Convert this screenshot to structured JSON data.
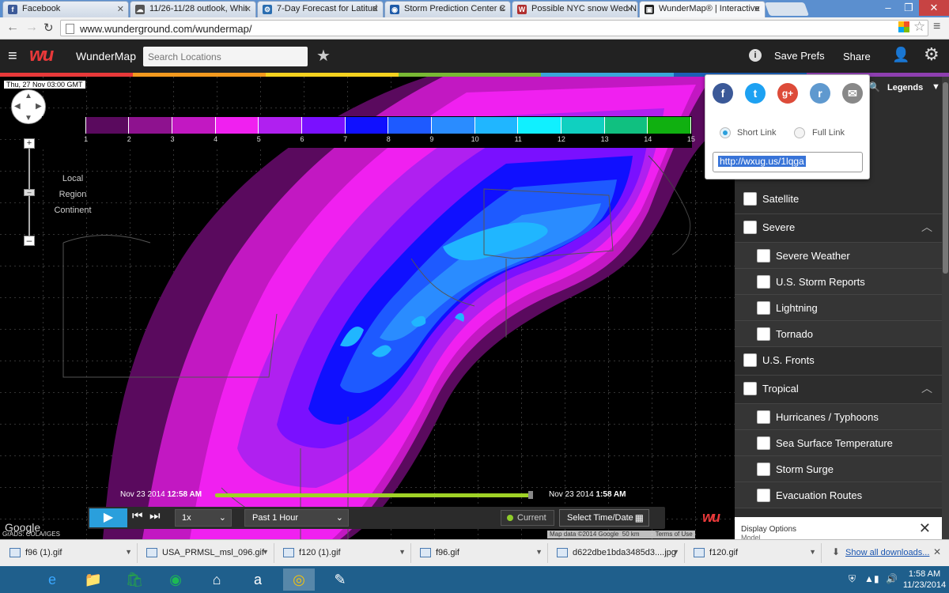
{
  "browser": {
    "tabs": [
      {
        "label": "Facebook",
        "icon": "facebook-icon",
        "color": "#3b5998",
        "glyph": "f"
      },
      {
        "label": "11/26-11/28 outlook, Whit",
        "icon": "forum-icon",
        "color": "#555555",
        "glyph": "☁"
      },
      {
        "label": "7-Day Forecast for Latitud",
        "icon": "nws-icon",
        "color": "#2a6db0",
        "glyph": "⚙"
      },
      {
        "label": "Storm Prediction Center C",
        "icon": "noaa-icon",
        "color": "#1e5aa8",
        "glyph": "◉"
      },
      {
        "label": "Possible NYC snow Wed N",
        "icon": "weather-forum-icon",
        "color": "#b03030",
        "glyph": "W"
      },
      {
        "label": "WunderMap® | Interactive",
        "icon": "wundermap-icon",
        "color": "#222222",
        "glyph": "▣"
      }
    ],
    "url": "www.wunderground.com/wundermap/"
  },
  "header": {
    "logo": "wu",
    "title": "WunderMap",
    "search_placeholder": "Search Locations",
    "save_prefs": "Save Prefs",
    "share": "Share"
  },
  "map": {
    "timestamp": "Thu, 27 Nov   03:00 GMT",
    "zoom_labels": [
      "Local",
      "Region",
      "Continent"
    ],
    "colorbar": {
      "labels": [
        "1",
        "2",
        "3",
        "4",
        "5",
        "6",
        "7",
        "8",
        "9",
        "10",
        "11",
        "12",
        "13",
        "14",
        "15"
      ],
      "colors": [
        "#000000",
        "#5a0a5e",
        "#8e128f",
        "#c218c2",
        "#f020f0",
        "#b020f0",
        "#7a10ff",
        "#1010ff",
        "#1e5aff",
        "#2a8cff",
        "#20b6ff",
        "#10f0ff",
        "#10d0c0",
        "#10c080",
        "#10b010"
      ]
    },
    "google_logo": "Google",
    "grads": "GrADS: COLA/IGES",
    "attribution": {
      "map_data": "Map data ©2014 Google",
      "scale": "50 km",
      "terms": "Terms of Use"
    }
  },
  "timeline": {
    "start_date": "Nov 23 2014",
    "start_time": "12:58 AM",
    "end_date": "Nov 23 2014",
    "end_time": "1:58 AM",
    "speed": "1x",
    "range": "Past 1 Hour",
    "current": "Current",
    "select_time": "Select Time/Date"
  },
  "share_popup": {
    "social": [
      {
        "name": "facebook",
        "glyph": "f",
        "color": "#3b5998"
      },
      {
        "name": "twitter",
        "glyph": "t",
        "color": "#1da1f2"
      },
      {
        "name": "google-plus",
        "glyph": "g+",
        "color": "#dd4b39"
      },
      {
        "name": "reddit",
        "glyph": "r",
        "color": "#5f99cf"
      },
      {
        "name": "email",
        "glyph": "✉",
        "color": "#888888"
      }
    ],
    "short_link": "Short Link",
    "full_link": "Full Link",
    "link": "http://wxug.us/1lqga",
    "legends": "Legends"
  },
  "layers": [
    {
      "label": "Satellite",
      "sub": false,
      "chevron": false
    },
    {
      "label": "Severe",
      "sub": false,
      "chevron": true
    },
    {
      "label": "Severe Weather",
      "sub": true
    },
    {
      "label": "U.S. Storm Reports",
      "sub": true
    },
    {
      "label": "Lightning",
      "sub": true
    },
    {
      "label": "Tornado",
      "sub": true
    },
    {
      "label": "U.S. Fronts",
      "sub": false,
      "chevron": false
    },
    {
      "label": "Tropical",
      "sub": false,
      "chevron": true
    },
    {
      "label": "Hurricanes / Typhoons",
      "sub": true
    },
    {
      "label": "Sea Surface Temperature",
      "sub": true
    },
    {
      "label": "Storm Surge",
      "sub": true
    },
    {
      "label": "Evacuation Routes",
      "sub": true
    }
  ],
  "display_options": {
    "label": "Display Options",
    "sub": "Model"
  },
  "downloads": {
    "items": [
      "f96 (1).gif",
      "USA_PRMSL_msl_096.gif",
      "f120 (1).gif",
      "f96.gif",
      "d622dbe1bda3485d3....jpg",
      "f120.gif"
    ],
    "show_all": "Show all downloads..."
  },
  "taskbar": {
    "apps": [
      "start",
      "ie",
      "explorer",
      "store",
      "spotify",
      "home",
      "amazon",
      "chrome",
      "app"
    ],
    "time": "1:58 AM",
    "date": "11/23/2014"
  }
}
